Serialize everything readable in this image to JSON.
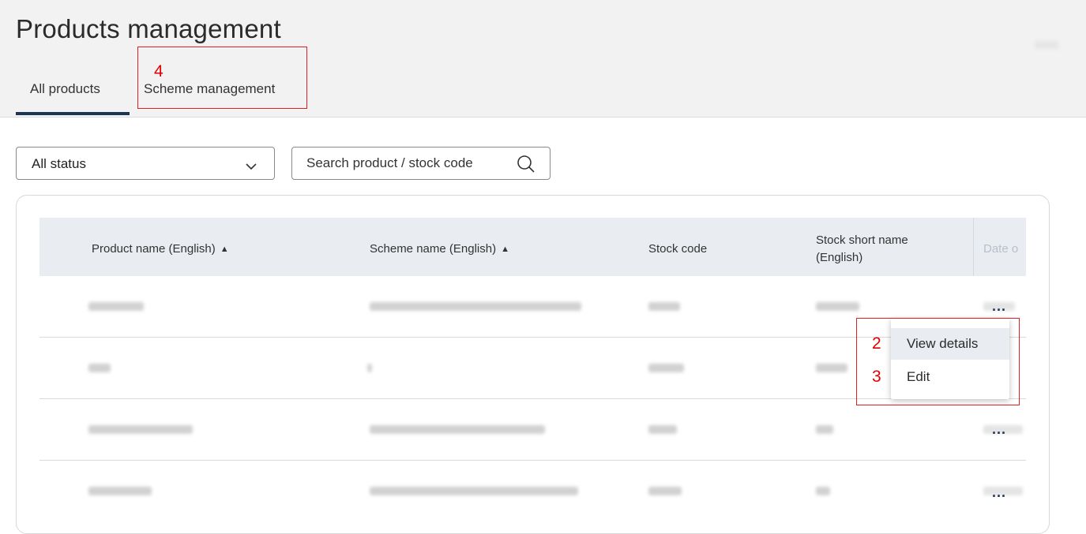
{
  "header": {
    "title": "Products management",
    "tabs": [
      {
        "label": "All products",
        "active": true
      },
      {
        "label": "Scheme management",
        "active": false
      }
    ]
  },
  "annotations": {
    "scheme_tab": "4",
    "view_details": "2",
    "edit": "3"
  },
  "filters": {
    "status_value": "All status",
    "search_placeholder": "Search product / stock code"
  },
  "table": {
    "columns": {
      "product_name": "Product name (English)",
      "scheme_name": "Scheme name (English)",
      "stock_code": "Stock code",
      "stock_short_name_line1": "Stock short name",
      "stock_short_name_line2": "(English)",
      "date": "Date o"
    },
    "row_action_label": "..."
  },
  "row_menu": {
    "items": [
      "View details",
      "Edit"
    ]
  },
  "colors": {
    "accent": "#1f3352",
    "annotation": "#e02020",
    "header_bg": "#f2f2f2",
    "table_header_bg": "#e9ecf1"
  },
  "icons": [
    "chevron-down-icon",
    "search-icon",
    "sort-icon",
    "more-icon"
  ]
}
